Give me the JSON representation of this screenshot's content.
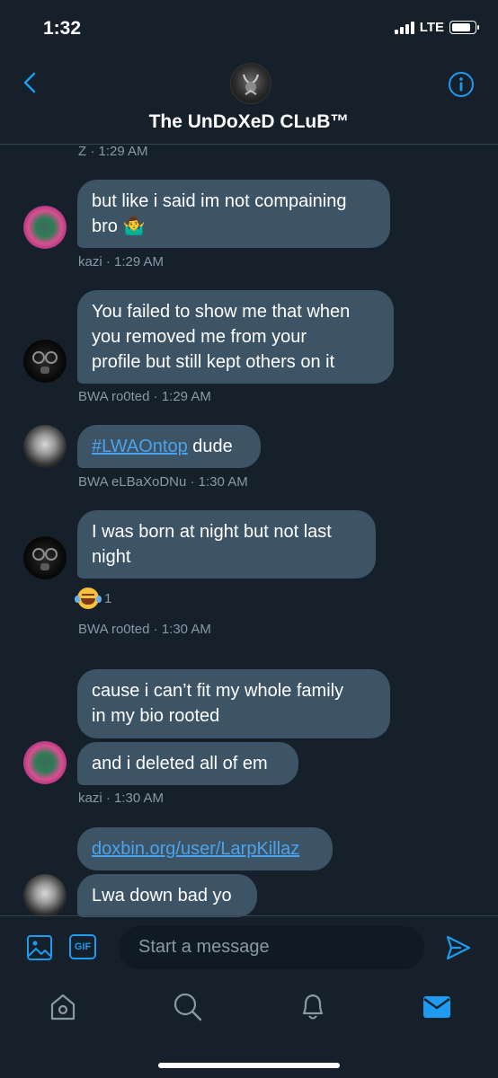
{
  "status": {
    "time": "1:32",
    "network": "LTE"
  },
  "header": {
    "title": "The UnDoXeD CLuB™"
  },
  "messages": [
    {
      "meta": "Z · 1:29 AM"
    },
    {
      "text": "but like i said im not compaining bro 🤷‍♂️",
      "line1": "but like i said im not compaining",
      "line2": "bro",
      "emoji": "🤷‍♂️",
      "meta": "kazi · 1:29 AM"
    },
    {
      "line1": "You failed to show me that when",
      "line2": "you removed me from your",
      "line3": "profile but still kept others on it",
      "meta": "BWA ro0ted · 1:29 AM"
    },
    {
      "hashtag": "#LWAOntop",
      "rest": " dude",
      "meta": "BWA eLBaXoDNu · 1:30 AM"
    },
    {
      "line1": "I was born at night but not last",
      "line2": "night",
      "reaction_count": "1",
      "meta": "BWA ro0ted · 1:30 AM"
    },
    {
      "line1": "cause i can’t fit my whole family",
      "line2": "in my bio rooted",
      "meta": ""
    },
    {
      "text": "and i deleted all of em",
      "meta": "kazi · 1:30 AM"
    },
    {
      "link": "doxbin.org/user/LarpKillaz"
    },
    {
      "text": "Lwa down bad yo"
    }
  ],
  "composer": {
    "placeholder": "Start a message",
    "gif_label": "GIF"
  },
  "icons": [
    "back-chevron-icon",
    "info-icon",
    "image-icon",
    "gif-icon",
    "send-icon",
    "home-icon",
    "search-icon",
    "notifications-icon",
    "messages-icon"
  ],
  "colors": {
    "background": "#15202b",
    "bubble": "#3d5466",
    "accent": "#1d9bf0",
    "meta": "#8899a6"
  }
}
